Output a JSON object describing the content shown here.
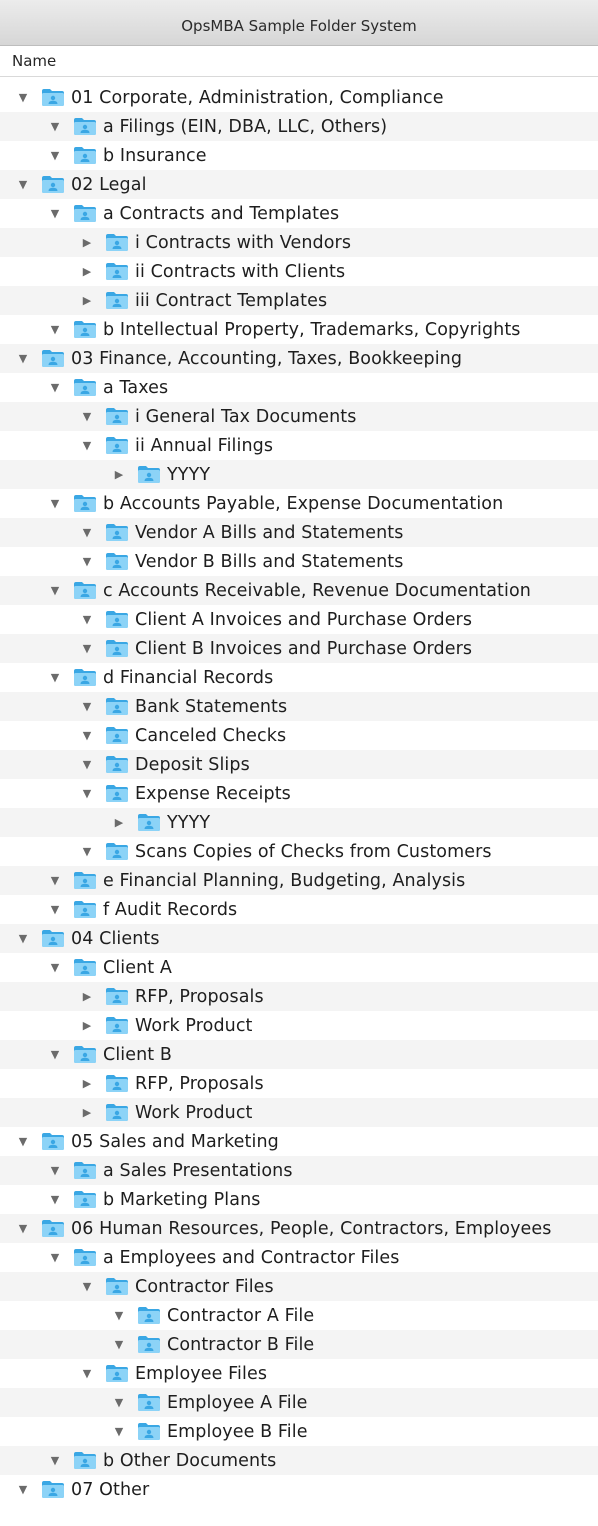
{
  "window": {
    "title": "OpsMBA Sample Folder System"
  },
  "header": {
    "name_column": "Name"
  },
  "icons": {
    "expanded": "disclosure-triangle-down",
    "collapsed": "disclosure-triangle-right",
    "folder": "shared-folder-icon"
  },
  "colors": {
    "folder_light": "#8cd3f7",
    "folder_dark": "#3aa7e4",
    "disclosure": "#6b6b6b",
    "row_alt": "#f4f4f4"
  },
  "rows": [
    {
      "level": 0,
      "state": "expanded",
      "label": "01 Corporate, Administration, Compliance"
    },
    {
      "level": 1,
      "state": "expanded",
      "label": "a Filings (EIN, DBA, LLC, Others)"
    },
    {
      "level": 1,
      "state": "expanded",
      "label": "b Insurance"
    },
    {
      "level": 0,
      "state": "expanded",
      "label": "02 Legal"
    },
    {
      "level": 1,
      "state": "expanded",
      "label": "a Contracts and Templates"
    },
    {
      "level": 2,
      "state": "collapsed",
      "label": "i Contracts with Vendors"
    },
    {
      "level": 2,
      "state": "collapsed",
      "label": "ii Contracts with Clients"
    },
    {
      "level": 2,
      "state": "collapsed",
      "label": "iii Contract Templates"
    },
    {
      "level": 1,
      "state": "expanded",
      "label": "b Intellectual Property, Trademarks, Copyrights"
    },
    {
      "level": 0,
      "state": "expanded",
      "label": "03 Finance, Accounting, Taxes, Bookkeeping"
    },
    {
      "level": 1,
      "state": "expanded",
      "label": "a Taxes"
    },
    {
      "level": 2,
      "state": "expanded",
      "label": "i General Tax Documents"
    },
    {
      "level": 2,
      "state": "expanded",
      "label": "ii Annual Filings"
    },
    {
      "level": 3,
      "state": "collapsed",
      "label": "YYYY"
    },
    {
      "level": 1,
      "state": "expanded",
      "label": "b Accounts Payable, Expense Documentation"
    },
    {
      "level": 2,
      "state": "expanded",
      "label": "Vendor A Bills and Statements"
    },
    {
      "level": 2,
      "state": "expanded",
      "label": "Vendor B Bills and Statements"
    },
    {
      "level": 1,
      "state": "expanded",
      "label": "c Accounts Receivable, Revenue Documentation"
    },
    {
      "level": 2,
      "state": "expanded",
      "label": "Client A Invoices and Purchase Orders"
    },
    {
      "level": 2,
      "state": "expanded",
      "label": "Client B Invoices and Purchase Orders"
    },
    {
      "level": 1,
      "state": "expanded",
      "label": "d Financial Records"
    },
    {
      "level": 2,
      "state": "expanded",
      "label": "Bank Statements"
    },
    {
      "level": 2,
      "state": "expanded",
      "label": "Canceled Checks"
    },
    {
      "level": 2,
      "state": "expanded",
      "label": "Deposit Slips"
    },
    {
      "level": 2,
      "state": "expanded",
      "label": "Expense Receipts"
    },
    {
      "level": 3,
      "state": "collapsed",
      "label": "YYYY"
    },
    {
      "level": 2,
      "state": "expanded",
      "label": "Scans Copies of Checks from Customers"
    },
    {
      "level": 1,
      "state": "expanded",
      "label": "e Financial Planning, Budgeting, Analysis"
    },
    {
      "level": 1,
      "state": "expanded",
      "label": "f Audit Records"
    },
    {
      "level": 0,
      "state": "expanded",
      "label": "04 Clients"
    },
    {
      "level": 1,
      "state": "expanded",
      "label": "Client A"
    },
    {
      "level": 2,
      "state": "collapsed",
      "label": "RFP, Proposals"
    },
    {
      "level": 2,
      "state": "collapsed",
      "label": "Work Product"
    },
    {
      "level": 1,
      "state": "expanded",
      "label": "Client B"
    },
    {
      "level": 2,
      "state": "collapsed",
      "label": "RFP, Proposals"
    },
    {
      "level": 2,
      "state": "collapsed",
      "label": "Work Product"
    },
    {
      "level": 0,
      "state": "expanded",
      "label": "05 Sales and Marketing"
    },
    {
      "level": 1,
      "state": "expanded",
      "label": "a Sales Presentations"
    },
    {
      "level": 1,
      "state": "expanded",
      "label": "b Marketing Plans"
    },
    {
      "level": 0,
      "state": "expanded",
      "label": "06 Human Resources, People, Contractors, Employees"
    },
    {
      "level": 1,
      "state": "expanded",
      "label": "a Employees and Contractor Files"
    },
    {
      "level": 2,
      "state": "expanded",
      "label": "Contractor Files"
    },
    {
      "level": 3,
      "state": "expanded",
      "label": "Contractor A File"
    },
    {
      "level": 3,
      "state": "expanded",
      "label": "Contractor B File"
    },
    {
      "level": 2,
      "state": "expanded",
      "label": "Employee Files"
    },
    {
      "level": 3,
      "state": "expanded",
      "label": "Employee A File"
    },
    {
      "level": 3,
      "state": "expanded",
      "label": "Employee B File"
    },
    {
      "level": 1,
      "state": "expanded",
      "label": "b Other Documents"
    },
    {
      "level": 0,
      "state": "expanded",
      "label": "07 Other"
    }
  ]
}
